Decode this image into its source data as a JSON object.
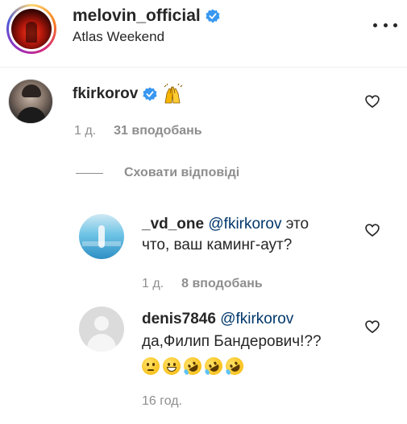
{
  "post": {
    "username": "melovin_official",
    "location": "Atlas Weekend",
    "avatar_icon": "post-avatar-image",
    "more_icon": "more-options-icon"
  },
  "comments": [
    {
      "username": "fkirkorov",
      "verified": true,
      "text_emoji": "raising-hands-emoji",
      "time": "1 д.",
      "likes": "31 вподобань"
    }
  ],
  "hide_replies": "Сховати відповіді",
  "replies": [
    {
      "username": "_vd_one",
      "mention": "@fkirkorov",
      "text_line1": " это",
      "text_line2": "что, ваш каминг-аут?",
      "time": "1 д.",
      "likes": "8 вподобань"
    },
    {
      "username": "denis7846",
      "mention": "@fkirkorov",
      "text_line2": "да,Филип Бандерович!??",
      "emojis": [
        "thinking-face-emoji",
        "grinning-face-emoji",
        "rofl-emoji",
        "rofl-emoji",
        "rofl-emoji"
      ],
      "time": "16 год."
    }
  ],
  "colors": {
    "text": "#262626",
    "secondary": "#8e8e8e",
    "mention": "#00376b",
    "verified": "#3897f0"
  }
}
